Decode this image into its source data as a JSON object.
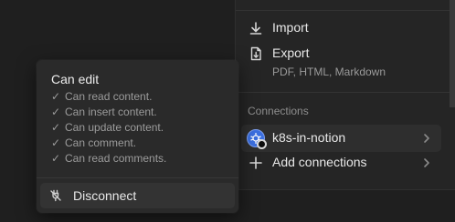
{
  "menu": {
    "import_label": "Import",
    "export_label": "Export",
    "export_sub": "PDF, HTML, Markdown",
    "connections_title": "Connections",
    "connection_name": "k8s-in-notion",
    "add_connections_label": "Add connections"
  },
  "popover": {
    "title": "Can edit",
    "permissions": [
      "Can read content.",
      "Can insert content.",
      "Can update content.",
      "Can comment.",
      "Can read comments."
    ],
    "disconnect_label": "Disconnect"
  },
  "icons": {
    "import": "download-arrow-icon",
    "export": "export-file-icon",
    "k8s": "kubernetes-icon",
    "add": "plus-icon",
    "chevron": "chevron-right-icon",
    "disconnect": "unplug-icon",
    "check": "check-icon"
  },
  "colors": {
    "background": "#1f1f1f",
    "menu": "#252525",
    "popover": "#2a2a2a",
    "hover": "#2e2e2e",
    "k8s_blue": "#3b6fe0"
  }
}
